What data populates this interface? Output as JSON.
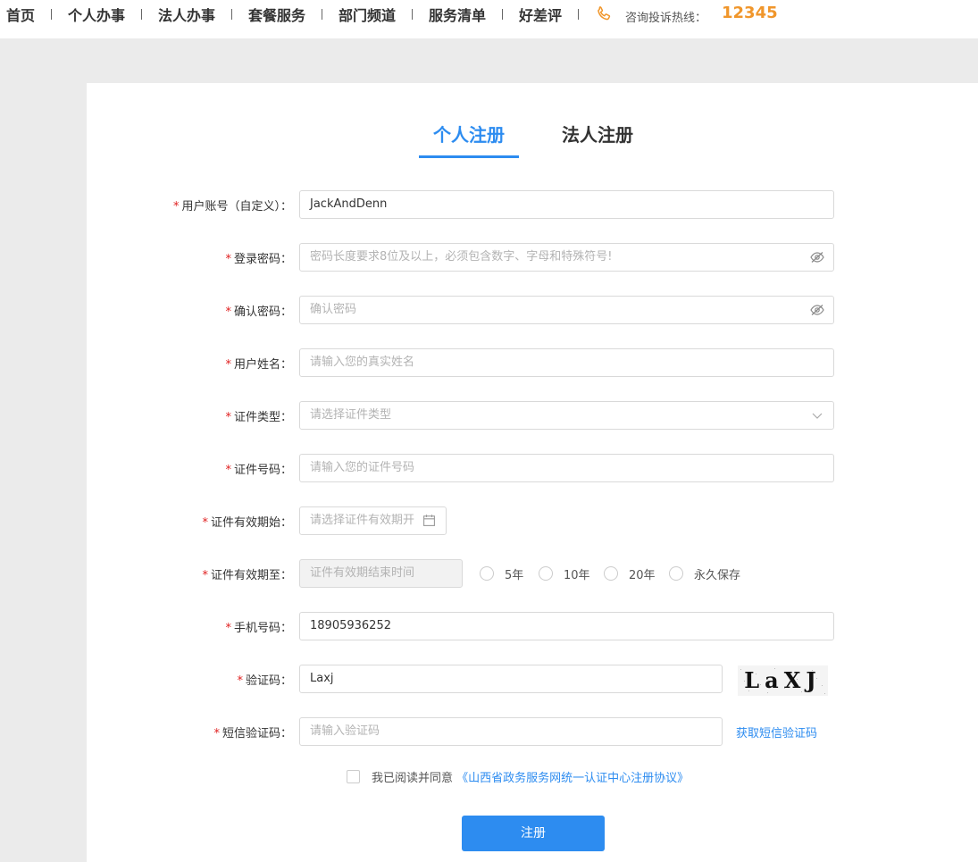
{
  "nav": {
    "items": [
      "首页",
      "个人办事",
      "法人办事",
      "套餐服务",
      "部门频道",
      "服务清单",
      "好差评"
    ],
    "hotline_label": "咨询投诉热线：",
    "hotline_number": "12345",
    "hotline_icon": "phone-icon"
  },
  "tabs": {
    "personal": "个人注册",
    "legal": "法人注册",
    "active": "personal"
  },
  "form": {
    "account_label": "用户账号（自定义）：",
    "account_value": "JackAndDenn",
    "password_label": "登录密码：",
    "password_placeholder": "密码长度要求8位及以上，必须包含数字、字母和特殊符号!",
    "confirm_label": "确认密码：",
    "confirm_placeholder": "确认密码",
    "name_label": "用户姓名：",
    "name_placeholder": "请输入您的真实姓名",
    "idtype_label": "证件类型：",
    "idtype_placeholder": "请选择证件类型",
    "idno_label": "证件号码：",
    "idno_placeholder": "请输入您的证件号码",
    "valid_start_label": "证件有效期始：",
    "valid_start_placeholder": "请选择证件有效期开",
    "valid_end_label": "证件有效期至：",
    "valid_end_placeholder": "证件有效期结束时间",
    "validity_options": [
      "5年",
      "10年",
      "20年",
      "永久保存"
    ],
    "phone_label": "手机号码：",
    "phone_value": "18905936252",
    "captcha_label": "验证码：",
    "captcha_value": "Laxj",
    "captcha_image_text": "LaXJ",
    "sms_label": "短信验证码：",
    "sms_placeholder": "请输入验证码",
    "sms_link": "获取短信验证码",
    "required_mark": "*"
  },
  "agreement": {
    "text": "我已阅读并同意",
    "link": "《山西省政务服务网统一认证中心注册协议》",
    "checked": false
  },
  "submit_label": "注册",
  "colors": {
    "accent": "#2d8cf0",
    "hotline": "#f0962b",
    "required": "#e02020",
    "background": "#ebebeb"
  }
}
